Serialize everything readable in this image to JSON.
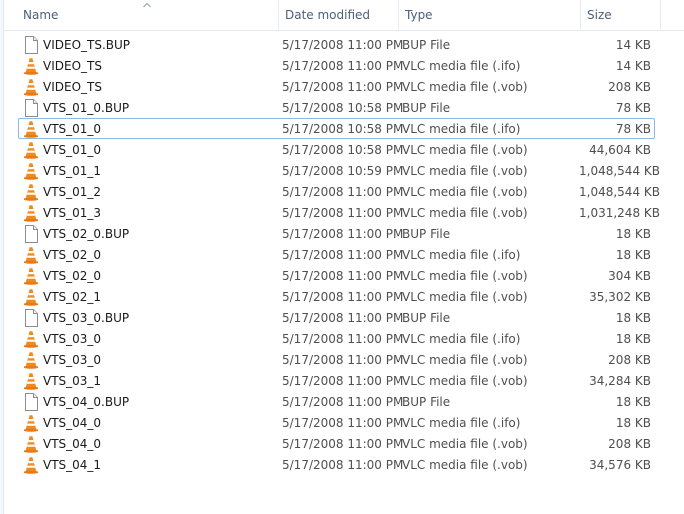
{
  "columns": {
    "name": "Name",
    "date": "Date modified",
    "type": "Type",
    "size": "Size"
  },
  "icons": {
    "bup": "document-icon",
    "vlc": "vlc-cone-icon"
  },
  "colors": {
    "header_text": "#4c607a",
    "focus_border": "#8fb8e5",
    "vlc_orange": "#f08a1c"
  },
  "files": [
    {
      "name": "VIDEO_TS.BUP",
      "date": "5/17/2008 11:00 PM",
      "type": "BUP File",
      "size": "14 KB",
      "icon": "bup"
    },
    {
      "name": "VIDEO_TS",
      "date": "5/17/2008 11:00 PM",
      "type": "VLC media file (.ifo)",
      "size": "14 KB",
      "icon": "vlc"
    },
    {
      "name": "VIDEO_TS",
      "date": "5/17/2008 11:00 PM",
      "type": "VLC media file (.vob)",
      "size": "208 KB",
      "icon": "vlc"
    },
    {
      "name": "VTS_01_0.BUP",
      "date": "5/17/2008 10:58 PM",
      "type": "BUP File",
      "size": "78 KB",
      "icon": "bup"
    },
    {
      "name": "VTS_01_0",
      "date": "5/17/2008 10:58 PM",
      "type": "VLC media file (.ifo)",
      "size": "78 KB",
      "icon": "vlc",
      "focused": true
    },
    {
      "name": "VTS_01_0",
      "date": "5/17/2008 10:58 PM",
      "type": "VLC media file (.vob)",
      "size": "44,604 KB",
      "icon": "vlc"
    },
    {
      "name": "VTS_01_1",
      "date": "5/17/2008 10:59 PM",
      "type": "VLC media file (.vob)",
      "size": "1,048,544 KB",
      "icon": "vlc"
    },
    {
      "name": "VTS_01_2",
      "date": "5/17/2008 11:00 PM",
      "type": "VLC media file (.vob)",
      "size": "1,048,544 KB",
      "icon": "vlc"
    },
    {
      "name": "VTS_01_3",
      "date": "5/17/2008 11:00 PM",
      "type": "VLC media file (.vob)",
      "size": "1,031,248 KB",
      "icon": "vlc"
    },
    {
      "name": "VTS_02_0.BUP",
      "date": "5/17/2008 11:00 PM",
      "type": "BUP File",
      "size": "18 KB",
      "icon": "bup"
    },
    {
      "name": "VTS_02_0",
      "date": "5/17/2008 11:00 PM",
      "type": "VLC media file (.ifo)",
      "size": "18 KB",
      "icon": "vlc"
    },
    {
      "name": "VTS_02_0",
      "date": "5/17/2008 11:00 PM",
      "type": "VLC media file (.vob)",
      "size": "304 KB",
      "icon": "vlc"
    },
    {
      "name": "VTS_02_1",
      "date": "5/17/2008 11:00 PM",
      "type": "VLC media file (.vob)",
      "size": "35,302 KB",
      "icon": "vlc"
    },
    {
      "name": "VTS_03_0.BUP",
      "date": "5/17/2008 11:00 PM",
      "type": "BUP File",
      "size": "18 KB",
      "icon": "bup"
    },
    {
      "name": "VTS_03_0",
      "date": "5/17/2008 11:00 PM",
      "type": "VLC media file (.ifo)",
      "size": "18 KB",
      "icon": "vlc"
    },
    {
      "name": "VTS_03_0",
      "date": "5/17/2008 11:00 PM",
      "type": "VLC media file (.vob)",
      "size": "208 KB",
      "icon": "vlc"
    },
    {
      "name": "VTS_03_1",
      "date": "5/17/2008 11:00 PM",
      "type": "VLC media file (.vob)",
      "size": "34,284 KB",
      "icon": "vlc"
    },
    {
      "name": "VTS_04_0.BUP",
      "date": "5/17/2008 11:00 PM",
      "type": "BUP File",
      "size": "18 KB",
      "icon": "bup"
    },
    {
      "name": "VTS_04_0",
      "date": "5/17/2008 11:00 PM",
      "type": "VLC media file (.ifo)",
      "size": "18 KB",
      "icon": "vlc"
    },
    {
      "name": "VTS_04_0",
      "date": "5/17/2008 11:00 PM",
      "type": "VLC media file (.vob)",
      "size": "208 KB",
      "icon": "vlc"
    },
    {
      "name": "VTS_04_1",
      "date": "5/17/2008 11:00 PM",
      "type": "VLC media file (.vob)",
      "size": "34,576 KB",
      "icon": "vlc"
    }
  ]
}
